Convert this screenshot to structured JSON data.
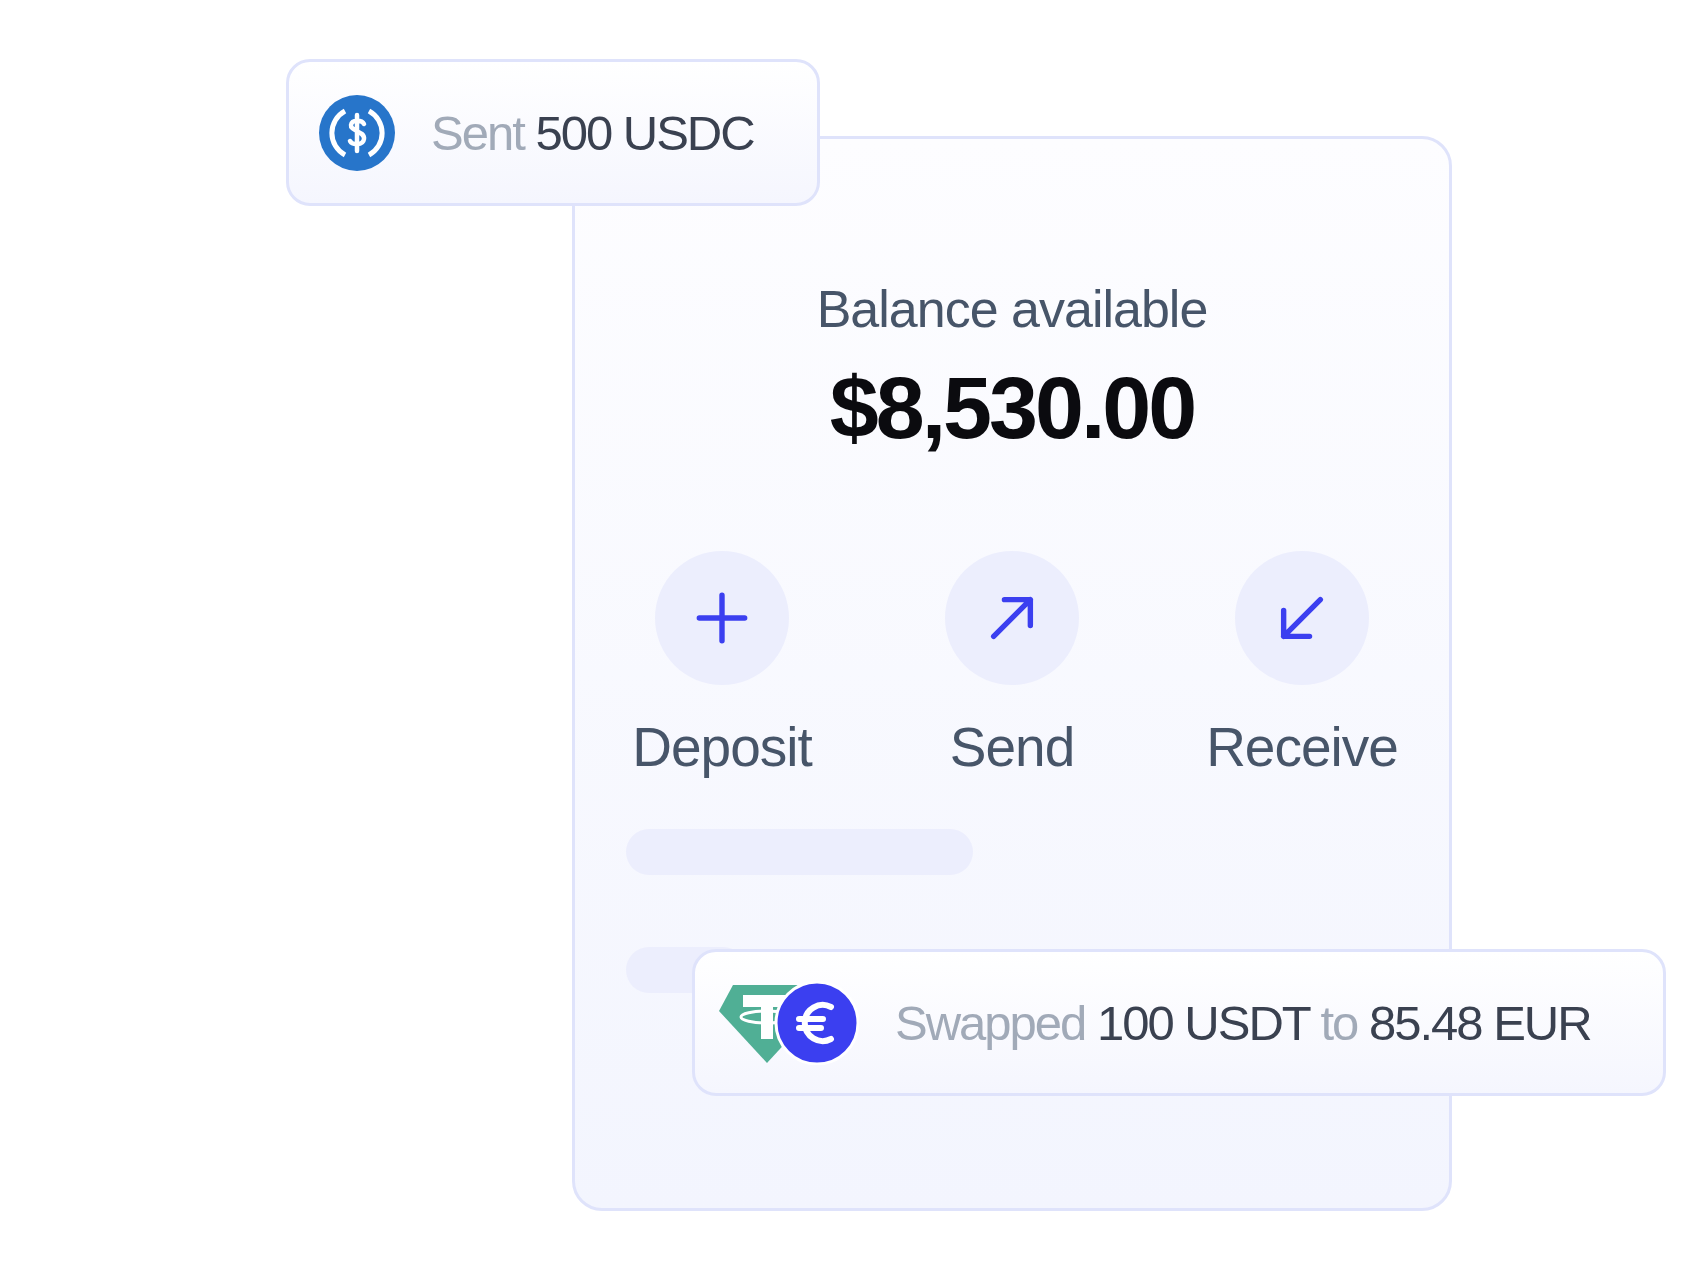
{
  "sent_toast": {
    "segments": [
      {
        "text": "Sent",
        "kind": "muted"
      },
      {
        "text": "500 USDC",
        "kind": "strong"
      }
    ]
  },
  "balance": {
    "label": "Balance available",
    "amount": "$8,530.00"
  },
  "actions": [
    {
      "label": "Deposit",
      "kind": "plus"
    },
    {
      "label": "Send",
      "kind": "send"
    },
    {
      "label": "Receive",
      "kind": "receive"
    }
  ],
  "swap_toast": {
    "segments": [
      {
        "text": "Swapped",
        "kind": "muted"
      },
      {
        "text": "100 USDT",
        "kind": "strong"
      },
      {
        "text": "to",
        "kind": "muted"
      },
      {
        "text": "85.48 EUR",
        "kind": "strong"
      }
    ]
  }
}
